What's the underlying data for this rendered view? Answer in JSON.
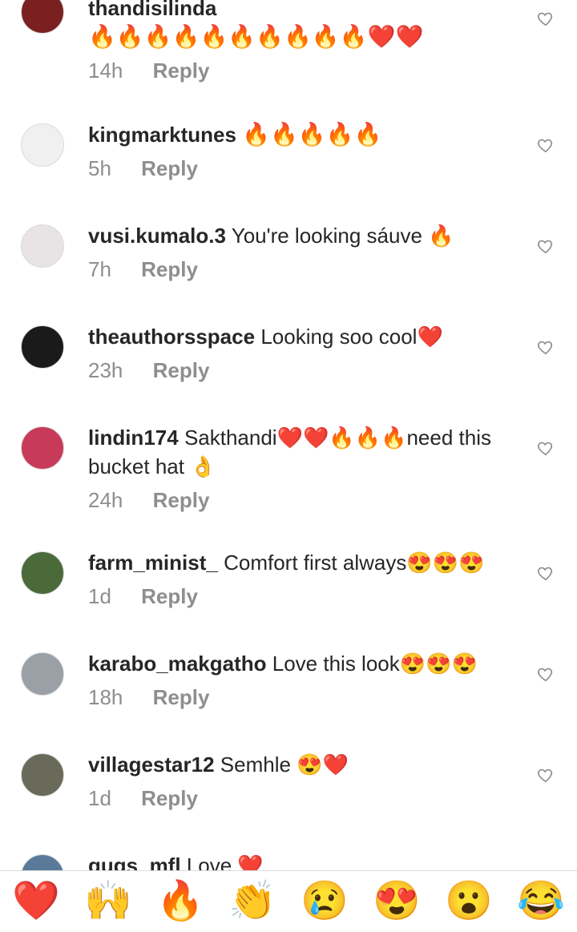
{
  "comments": [
    {
      "user": "thandisilinda",
      "text": "🔥🔥🔥🔥🔥🔥🔥🔥🔥🔥❤️❤️",
      "time": "14h",
      "reply": "Reply",
      "avatar_color": "#7a2020"
    },
    {
      "user": "kingmarktunes",
      "text": "🔥🔥🔥🔥🔥",
      "time": "5h",
      "reply": "Reply",
      "avatar_color": "#f0f0f0"
    },
    {
      "user": "vusi.kumalo.3",
      "text": "You're looking sáuve 🔥",
      "time": "7h",
      "reply": "Reply",
      "avatar_color": "#e8e4e6"
    },
    {
      "user": "theauthorsspace",
      "text": "Looking soo cool❤️",
      "time": "23h",
      "reply": "Reply",
      "avatar_color": "#1a1a1a"
    },
    {
      "user": "lindin174",
      "text": "Sakthandi❤️❤️🔥🔥🔥need this bucket hat 👌",
      "time": "24h",
      "reply": "Reply",
      "avatar_color": "#c83a5a"
    },
    {
      "user": "farm_minist_",
      "text": "Comfort first always😍😍😍",
      "time": "1d",
      "reply": "Reply",
      "avatar_color": "#4a6a3a"
    },
    {
      "user": "karabo_makgatho",
      "text": "Love this look😍😍😍",
      "time": "18h",
      "reply": "Reply",
      "avatar_color": "#9aa0a6"
    },
    {
      "user": "villagestar12",
      "text": "Semhle 😍❤️",
      "time": "1d",
      "reply": "Reply",
      "avatar_color": "#6a6a5a"
    },
    {
      "user": "gugs_mfl",
      "text": "Love ❤️",
      "time": "",
      "reply": "",
      "avatar_color": "#5a7a9a"
    }
  ],
  "quick_reactions": [
    "❤️",
    "🙌",
    "🔥",
    "👏",
    "😢",
    "😍",
    "😮",
    "😂"
  ]
}
